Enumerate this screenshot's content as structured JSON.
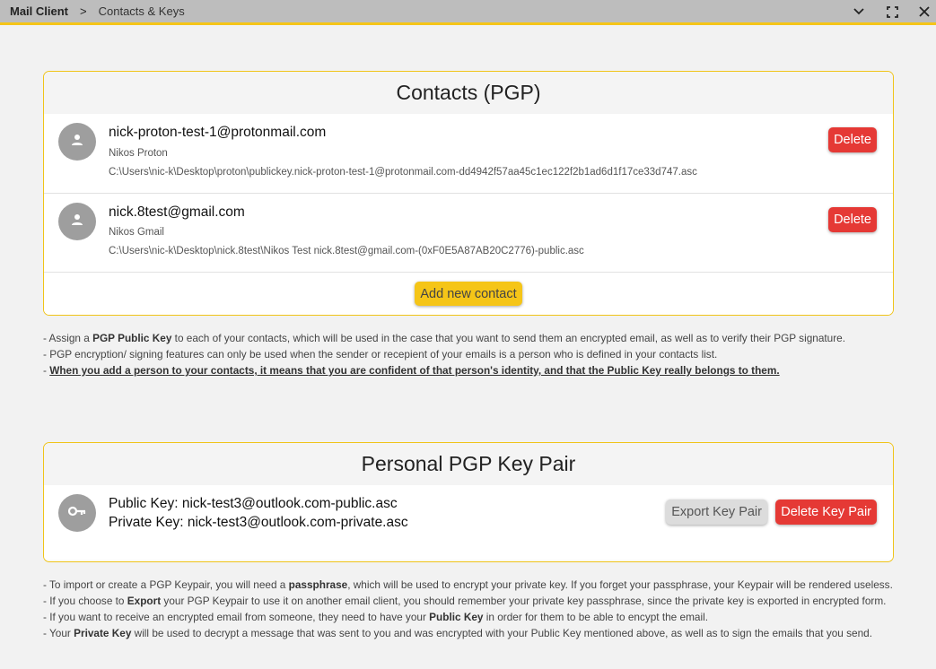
{
  "titlebar": {
    "app": "Mail Client",
    "separator": ">",
    "page": "Contacts & Keys",
    "icons": [
      "chevron-down-icon",
      "fullscreen-icon",
      "close-icon"
    ]
  },
  "contacts": {
    "title": "Contacts (PGP)",
    "items": [
      {
        "email": "nick-proton-test-1@protonmail.com",
        "name": "Nikos Proton",
        "path": "C:\\Users\\nic-k\\Desktop\\proton\\publickey.nick-proton-test-1@protonmail.com-dd4942f57aa45c1ec122f2b1ad6d1f17ce33d747.asc",
        "delete_label": "Delete"
      },
      {
        "email": "nick.8test@gmail.com",
        "name": "Nikos Gmail",
        "path": "C:\\Users\\nic-k\\Desktop\\nick.8test\\Nikos Test nick.8test@gmail.com-(0xF0E5A87AB20C2776)-public.asc",
        "delete_label": "Delete"
      }
    ],
    "add_label": "Add new contact"
  },
  "contact_notes": {
    "line1_pre": "- Assign a ",
    "line1_bold": "PGP Public Key",
    "line1_post": " to each of your contacts, which will be used in the case that you want to send them an encrypted email, as well as to verify their PGP signature.",
    "line2": "- PGP encryption/ signing features can only be used when the sender or recepient of your emails is a person who is defined in your contacts list.",
    "line3_pre": "- ",
    "line3_underlined": "When you add a person to your contacts, it means that you are confident of that person's identity, and that the Public Key really belongs to them."
  },
  "keypair": {
    "title": "Personal PGP Key Pair",
    "public_key": "Public Key: nick-test3@outlook.com-public.asc",
    "private_key": "Private Key: nick-test3@outlook.com-private.asc",
    "export_label": "Export Key Pair",
    "delete_label": "Delete Key Pair"
  },
  "keypair_notes": {
    "l1_pre": "- To import or create a PGP Keypair, you will need a ",
    "l1_bold": "passphrase",
    "l1_post": ", which will be used to encrypt your private key. If you forget your passphrase, your Keypair will be rendered useless.",
    "l2_pre": "- If you choose to ",
    "l2_bold": "Export",
    "l2_post": " your PGP Keypair to use it on another email client, you should remember your private key passphrase, since the private key is exported in encrypted form.",
    "l3_pre": "- If you want to receive an encrypted email from someone, they need to have your ",
    "l3_bold": "Public Key",
    "l3_post": " in order for them to be able to encypt the email.",
    "l4_pre": "- Your ",
    "l4_bold": "Private Key",
    "l4_post": " will be used to decrypt a message that was sent to you and was encrypted with your Public Key mentioned above, as well as to sign the emails that you send."
  },
  "colors": {
    "accent": "#f5c518",
    "danger": "#e53935",
    "titlebar": "#bdbdbd"
  }
}
